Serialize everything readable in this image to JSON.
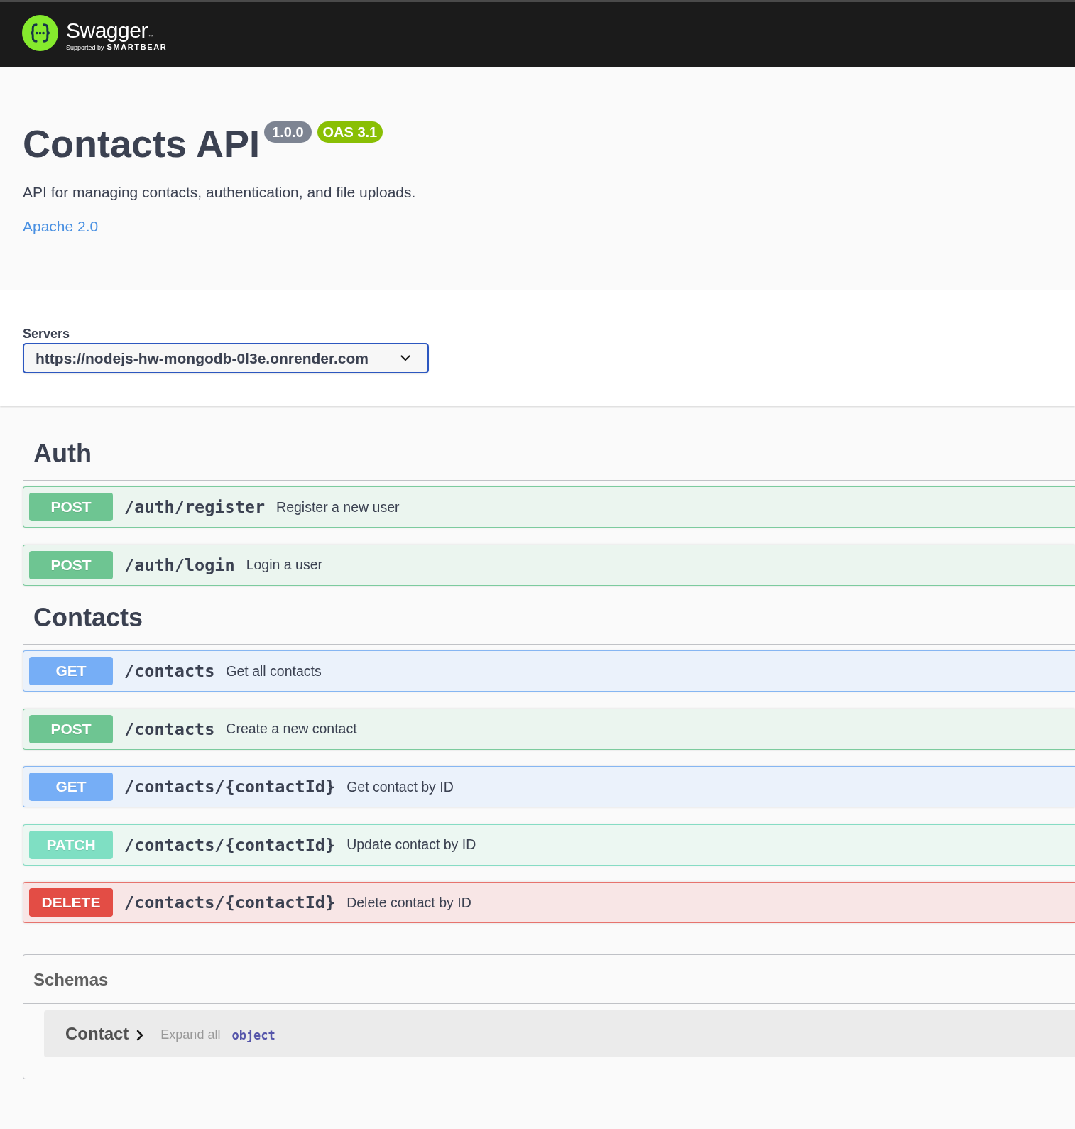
{
  "header": {
    "brand": "Swagger",
    "trademark": "™",
    "tagline": "Supported by",
    "company": "SMARTBEAR"
  },
  "info": {
    "title": "Contacts API",
    "version": "1.0.0",
    "spec_version": "OAS 3.1",
    "description": "API for managing contacts, authentication, and file uploads.",
    "license_link": "Apache 2.0"
  },
  "servers": {
    "label": "Servers",
    "value": "https://nodejs-hw-mongodb-0l3e.onrender.com"
  },
  "tags": [
    {
      "name": "Auth",
      "operations": [
        {
          "kind": "post",
          "method": "POST",
          "path": "/auth/register",
          "summary": "Register a new user"
        },
        {
          "kind": "post",
          "method": "POST",
          "path": "/auth/login",
          "summary": "Login a user"
        }
      ]
    },
    {
      "name": "Contacts",
      "operations": [
        {
          "kind": "get",
          "method": "GET",
          "path": "/contacts",
          "summary": "Get all contacts"
        },
        {
          "kind": "post",
          "method": "POST",
          "path": "/contacts",
          "summary": "Create a new contact"
        },
        {
          "kind": "get",
          "method": "GET",
          "path": "/contacts/{contactId}",
          "summary": "Get contact by ID"
        },
        {
          "kind": "patch",
          "method": "PATCH",
          "path": "/contacts/{contactId}",
          "summary": "Update contact by ID"
        },
        {
          "kind": "delete",
          "method": "DELETE",
          "path": "/contacts/{contactId}",
          "summary": "Delete contact by ID"
        }
      ]
    }
  ],
  "schemas": {
    "title": "Schemas",
    "models": [
      {
        "name": "Contact",
        "expanded": false,
        "expand_label": "Expand all",
        "type": "object"
      }
    ]
  }
}
